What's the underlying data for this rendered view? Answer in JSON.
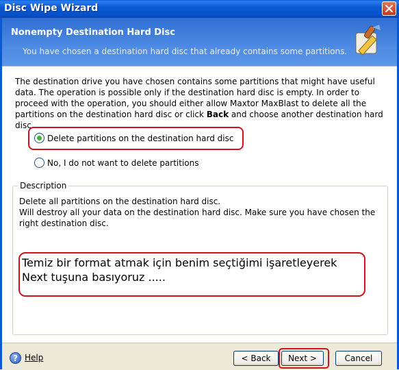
{
  "window": {
    "title": "Disc Wipe Wizard"
  },
  "header": {
    "title": "Nonempty Destination Hard Disc",
    "subtitle": "You have chosen a destination hard disc that already contains some partitions."
  },
  "body": {
    "intro_1": "The destination drive you have chosen contains some partitions that might have useful data. The operation is possible only if the destination hard disc is empty. In order to proceed with the operation, you should either allow Maxtor MaxBlast to delete all the partitions on the destination hard disc or click ",
    "intro_bold": "Back",
    "intro_2": " and choose another destination hard disc."
  },
  "options": {
    "delete_label": "Delete partitions on the destination hard disc",
    "keep_label": "No, I do not want to delete partitions",
    "selected": "delete"
  },
  "description": {
    "legend": "Description",
    "line_1": "Delete all partitions on the destination hard disc.",
    "line_2": "Will destroy all your data on the destination hard disc. Make sure you have chosen the right destination disc."
  },
  "annotation": {
    "line_1": "Temiz bir format atmak için benim seçtiğimi işaretleyerek",
    "line_2": "Next tuşuna basıyoruz ....."
  },
  "footer": {
    "help_label": "Help",
    "back_label": "< Back",
    "next_label": "Next >",
    "cancel_label": "Cancel"
  },
  "colors": {
    "titlebar": "#0b5bd6",
    "annotation_outline": "#d0121b",
    "radio_selected": "#3fb342"
  }
}
